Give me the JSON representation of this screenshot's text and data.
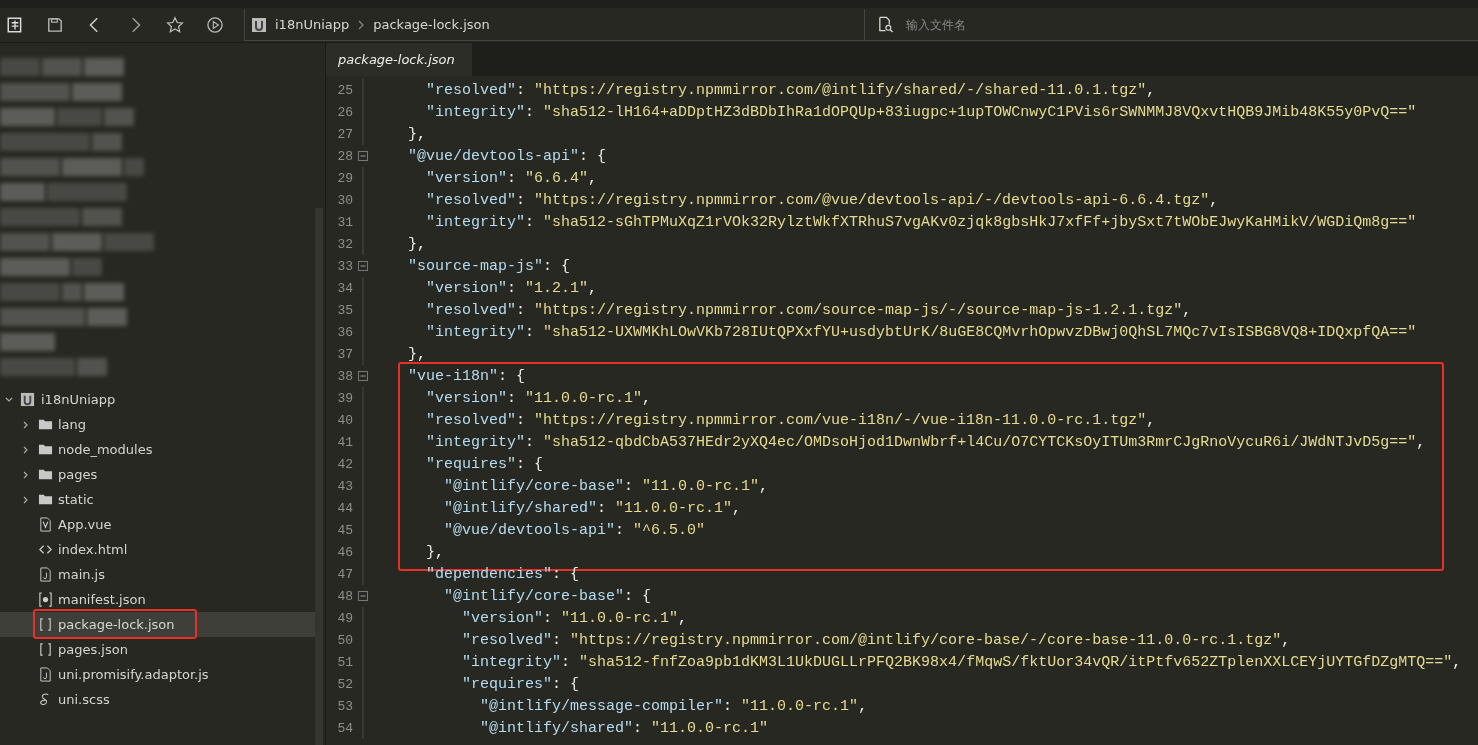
{
  "toolbar": {
    "breadcrumb": [
      "i18nUniapp",
      "package-lock.json"
    ]
  },
  "file_search": {
    "placeholder": "输入文件名"
  },
  "tabs": [
    {
      "label": "package-lock.json",
      "selected": true
    }
  ],
  "project_tree": {
    "label": "i18nUniapp",
    "expanded": true,
    "children": [
      {
        "label": "lang",
        "kind": "folder",
        "expanded": false,
        "selected": false,
        "boxed": false
      },
      {
        "label": "node_modules",
        "kind": "folder",
        "expanded": false,
        "selected": false,
        "boxed": false
      },
      {
        "label": "pages",
        "kind": "folder",
        "expanded": false,
        "selected": false,
        "boxed": false
      },
      {
        "label": "static",
        "kind": "folder",
        "expanded": false,
        "selected": false,
        "boxed": false
      },
      {
        "label": "App.vue",
        "kind": "vue",
        "selected": false,
        "boxed": false
      },
      {
        "label": "index.html",
        "kind": "html",
        "selected": false,
        "boxed": false
      },
      {
        "label": "main.js",
        "kind": "js",
        "selected": false,
        "boxed": false
      },
      {
        "label": "manifest.json",
        "kind": "manifest",
        "selected": false,
        "boxed": false
      },
      {
        "label": "package-lock.json",
        "kind": "json",
        "selected": true,
        "boxed": true
      },
      {
        "label": "pages.json",
        "kind": "json",
        "selected": false,
        "boxed": false
      },
      {
        "label": "uni.promisify.adaptor.js",
        "kind": "js",
        "selected": false,
        "boxed": false
      },
      {
        "label": "uni.scss",
        "kind": "scss",
        "selected": false,
        "boxed": false
      }
    ]
  },
  "editor": {
    "lines": [
      {
        "children": [
          {
            "number": "25",
            "fold": false,
            "boxed": false,
            "parts": [
              {
                "kind": "key",
                "text": "\"resolved\""
              },
              {
                "kind": "punct",
                "text": ": "
              },
              {
                "kind": "string",
                "text": "\"https://registry.npmmirror.com/@intlify/shared/-/shared-11.0.1.tgz\""
              },
              {
                "kind": "punct",
                "text": ","
              }
            ]
          },
          {
            "number": "26",
            "fold": false,
            "boxed": false,
            "parts": [
              {
                "kind": "key",
                "text": "\"integrity\""
              },
              {
                "kind": "punct",
                "text": ": "
              },
              {
                "kind": "string",
                "text": "\"sha512-lH164+aDDptHZ3dBDbIhRa1dOPQUp+83iugpc+1upTOWCnwyC1PVis6rSWNMMJ8VQxvtHQB9JMib48K55y0PvQ==\""
              }
            ]
          }
        ]
      },
      {
        "number": "27",
        "fold": false,
        "boxed": false,
        "parts": [
          {
            "kind": "punct",
            "text": "},"
          }
        ]
      },
      {
        "number": "28",
        "fold": true,
        "boxed": false,
        "parts": [
          {
            "kind": "key",
            "text": "\"@vue/devtools-api\""
          },
          {
            "kind": "punct",
            "text": ": {"
          }
        ],
        "children": [
          {
            "number": "29",
            "fold": false,
            "boxed": false,
            "parts": [
              {
                "kind": "key",
                "text": "\"version\""
              },
              {
                "kind": "punct",
                "text": ": "
              },
              {
                "kind": "string",
                "text": "\"6.6.4\""
              },
              {
                "kind": "punct",
                "text": ","
              }
            ]
          },
          {
            "number": "30",
            "fold": false,
            "boxed": false,
            "parts": [
              {
                "kind": "key",
                "text": "\"resolved\""
              },
              {
                "kind": "punct",
                "text": ": "
              },
              {
                "kind": "string",
                "text": "\"https://registry.npmmirror.com/@vue/devtools-api/-/devtools-api-6.6.4.tgz\""
              },
              {
                "kind": "punct",
                "text": ","
              }
            ]
          },
          {
            "number": "31",
            "fold": false,
            "boxed": false,
            "parts": [
              {
                "kind": "key",
                "text": "\"integrity\""
              },
              {
                "kind": "punct",
                "text": ": "
              },
              {
                "kind": "string",
                "text": "\"sha512-sGhTPMuXqZ1rVOk32RylztWkfXTRhuS7vgAKv0zjqk8gbsHkJ7xfFf+jbySxt7tWObEJwyKaHMikV/WGDiQm8g==\""
              }
            ]
          }
        ]
      },
      {
        "number": "32",
        "fold": false,
        "boxed": false,
        "parts": [
          {
            "kind": "punct",
            "text": "},"
          }
        ]
      },
      {
        "number": "33",
        "fold": true,
        "boxed": false,
        "parts": [
          {
            "kind": "key",
            "text": "\"source-map-js\""
          },
          {
            "kind": "punct",
            "text": ": {"
          }
        ],
        "children": [
          {
            "number": "34",
            "fold": false,
            "boxed": false,
            "parts": [
              {
                "kind": "key",
                "text": "\"version\""
              },
              {
                "kind": "punct",
                "text": ": "
              },
              {
                "kind": "string",
                "text": "\"1.2.1\""
              },
              {
                "kind": "punct",
                "text": ","
              }
            ]
          },
          {
            "number": "35",
            "fold": false,
            "boxed": false,
            "parts": [
              {
                "kind": "key",
                "text": "\"resolved\""
              },
              {
                "kind": "punct",
                "text": ": "
              },
              {
                "kind": "string",
                "text": "\"https://registry.npmmirror.com/source-map-js/-/source-map-js-1.2.1.tgz\""
              },
              {
                "kind": "punct",
                "text": ","
              }
            ]
          },
          {
            "number": "36",
            "fold": false,
            "boxed": false,
            "parts": [
              {
                "kind": "key",
                "text": "\"integrity\""
              },
              {
                "kind": "punct",
                "text": ": "
              },
              {
                "kind": "string",
                "text": "\"sha512-UXWMKhLOwVKb728IUtQPXxfYU+usdybtUrK/8uGE8CQMvrhOpwvzDBwj0QhSL7MQc7vIsISBG8VQ8+IDQxpfQA==\""
              }
            ]
          }
        ]
      },
      {
        "number": "37",
        "fold": false,
        "boxed": false,
        "parts": [
          {
            "kind": "punct",
            "text": "},"
          }
        ]
      },
      {
        "number": "38",
        "fold": true,
        "boxed": true,
        "parts": [
          {
            "kind": "key",
            "text": "\"vue-i18n\""
          },
          {
            "kind": "punct",
            "text": ": {"
          }
        ],
        "children": [
          {
            "number": "39",
            "fold": false,
            "boxed": true,
            "parts": [
              {
                "kind": "key",
                "text": "\"version\""
              },
              {
                "kind": "punct",
                "text": ": "
              },
              {
                "kind": "string",
                "text": "\"11.0.0-rc.1\""
              },
              {
                "kind": "punct",
                "text": ","
              }
            ]
          },
          {
            "number": "40",
            "fold": false,
            "boxed": true,
            "parts": [
              {
                "kind": "key",
                "text": "\"resolved\""
              },
              {
                "kind": "punct",
                "text": ": "
              },
              {
                "kind": "string",
                "text": "\"https://registry.npmmirror.com/vue-i18n/-/vue-i18n-11.0.0-rc.1.tgz\""
              },
              {
                "kind": "punct",
                "text": ","
              }
            ]
          },
          {
            "number": "41",
            "fold": false,
            "boxed": true,
            "parts": [
              {
                "kind": "key",
                "text": "\"integrity\""
              },
              {
                "kind": "punct",
                "text": ": "
              },
              {
                "kind": "string",
                "text": "\"sha512-qbdCbA537HEdr2yXQ4ec/OMDsoHjod1DwnWbrf+l4Cu/O7CYTCKsOyITUm3RmrCJgRnoVycuR6i/JWdNTJvD5g==\""
              },
              {
                "kind": "punct",
                "text": ","
              }
            ]
          },
          {
            "number": "42",
            "fold": false,
            "boxed": true,
            "parts": [
              {
                "kind": "key",
                "text": "\"requires\""
              },
              {
                "kind": "punct",
                "text": ": {"
              }
            ],
            "children": [
              {
                "number": "43",
                "fold": false,
                "boxed": true,
                "parts": [
                  {
                    "kind": "key",
                    "text": "\"@intlify/core-base\""
                  },
                  {
                    "kind": "punct",
                    "text": ": "
                  },
                  {
                    "kind": "string",
                    "text": "\"11.0.0-rc.1\""
                  },
                  {
                    "kind": "punct",
                    "text": ","
                  }
                ]
              },
              {
                "number": "44",
                "fold": false,
                "boxed": true,
                "parts": [
                  {
                    "kind": "key",
                    "text": "\"@intlify/shared\""
                  },
                  {
                    "kind": "punct",
                    "text": ": "
                  },
                  {
                    "kind": "string",
                    "text": "\"11.0.0-rc.1\""
                  },
                  {
                    "kind": "punct",
                    "text": ","
                  }
                ]
              },
              {
                "number": "45",
                "fold": false,
                "boxed": true,
                "parts": [
                  {
                    "kind": "key",
                    "text": "\"@vue/devtools-api\""
                  },
                  {
                    "kind": "punct",
                    "text": ": "
                  },
                  {
                    "kind": "string",
                    "text": "\"^6.5.0\""
                  }
                ]
              }
            ]
          },
          {
            "number": "46",
            "fold": false,
            "boxed": true,
            "parts": [
              {
                "kind": "punct",
                "text": "},"
              }
            ]
          },
          {
            "number": "47",
            "fold": false,
            "boxed": false,
            "parts": [
              {
                "kind": "key",
                "text": "\"dependencies\""
              },
              {
                "kind": "punct",
                "text": ": {"
              }
            ],
            "children": [
              {
                "number": "48",
                "fold": true,
                "boxed": false,
                "parts": [
                  {
                    "kind": "key",
                    "text": "\"@intlify/core-base\""
                  },
                  {
                    "kind": "punct",
                    "text": ": {"
                  }
                ],
                "children": [
                  {
                    "number": "49",
                    "fold": false,
                    "boxed": false,
                    "parts": [
                      {
                        "kind": "key",
                        "text": "\"version\""
                      },
                      {
                        "kind": "punct",
                        "text": ": "
                      },
                      {
                        "kind": "string",
                        "text": "\"11.0.0-rc.1\""
                      },
                      {
                        "kind": "punct",
                        "text": ","
                      }
                    ]
                  },
                  {
                    "number": "50",
                    "fold": false,
                    "boxed": false,
                    "parts": [
                      {
                        "kind": "key",
                        "text": "\"resolved\""
                      },
                      {
                        "kind": "punct",
                        "text": ": "
                      },
                      {
                        "kind": "string",
                        "text": "\"https://registry.npmmirror.com/@intlify/core-base/-/core-base-11.0.0-rc.1.tgz\""
                      },
                      {
                        "kind": "punct",
                        "text": ","
                      }
                    ]
                  },
                  {
                    "number": "51",
                    "fold": false,
                    "boxed": false,
                    "parts": [
                      {
                        "kind": "key",
                        "text": "\"integrity\""
                      },
                      {
                        "kind": "punct",
                        "text": ": "
                      },
                      {
                        "kind": "string",
                        "text": "\"sha512-fnfZoa9pb1dKM3L1UkDUGLLrPFQ2BK98x4/fMqwS/fktUor34vQR/itPtfv652ZTplenXXLCEYjUYTGfDZgMTQ==\""
                      },
                      {
                        "kind": "punct",
                        "text": ","
                      }
                    ]
                  },
                  {
                    "number": "52",
                    "fold": false,
                    "boxed": false,
                    "parts": [
                      {
                        "kind": "key",
                        "text": "\"requires\""
                      },
                      {
                        "kind": "punct",
                        "text": ": {"
                      }
                    ],
                    "children": [
                      {
                        "number": "53",
                        "fold": false,
                        "boxed": false,
                        "parts": [
                          {
                            "kind": "key",
                            "text": "\"@intlify/message-compiler\""
                          },
                          {
                            "kind": "punct",
                            "text": ": "
                          },
                          {
                            "kind": "string",
                            "text": "\"11.0.0-rc.1\""
                          },
                          {
                            "kind": "punct",
                            "text": ","
                          }
                        ]
                      },
                      {
                        "number": "54",
                        "fold": false,
                        "boxed": false,
                        "parts": [
                          {
                            "kind": "key",
                            "text": "\"@intlify/shared\""
                          },
                          {
                            "kind": "punct",
                            "text": ": "
                          },
                          {
                            "kind": "string",
                            "text": "\"11.0.0-rc.1\""
                          }
                        ]
                      }
                    ]
                  }
                ]
              }
            ]
          }
        ]
      }
    ]
  }
}
